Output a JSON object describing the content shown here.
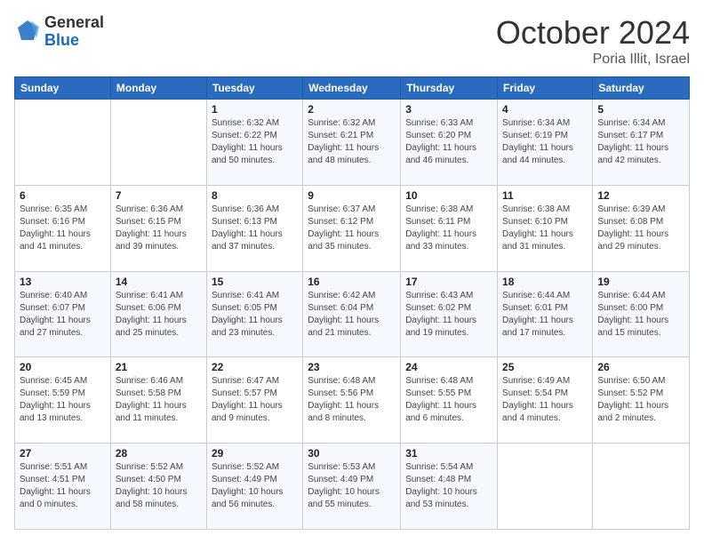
{
  "header": {
    "logo_general": "General",
    "logo_blue": "Blue",
    "month": "October 2024",
    "location": "Poria Illit, Israel"
  },
  "weekdays": [
    "Sunday",
    "Monday",
    "Tuesday",
    "Wednesday",
    "Thursday",
    "Friday",
    "Saturday"
  ],
  "weeks": [
    [
      {
        "day": "",
        "sunrise": "",
        "sunset": "",
        "daylight": ""
      },
      {
        "day": "",
        "sunrise": "",
        "sunset": "",
        "daylight": ""
      },
      {
        "day": "1",
        "sunrise": "Sunrise: 6:32 AM",
        "sunset": "Sunset: 6:22 PM",
        "daylight": "Daylight: 11 hours and 50 minutes."
      },
      {
        "day": "2",
        "sunrise": "Sunrise: 6:32 AM",
        "sunset": "Sunset: 6:21 PM",
        "daylight": "Daylight: 11 hours and 48 minutes."
      },
      {
        "day": "3",
        "sunrise": "Sunrise: 6:33 AM",
        "sunset": "Sunset: 6:20 PM",
        "daylight": "Daylight: 11 hours and 46 minutes."
      },
      {
        "day": "4",
        "sunrise": "Sunrise: 6:34 AM",
        "sunset": "Sunset: 6:19 PM",
        "daylight": "Daylight: 11 hours and 44 minutes."
      },
      {
        "day": "5",
        "sunrise": "Sunrise: 6:34 AM",
        "sunset": "Sunset: 6:17 PM",
        "daylight": "Daylight: 11 hours and 42 minutes."
      }
    ],
    [
      {
        "day": "6",
        "sunrise": "Sunrise: 6:35 AM",
        "sunset": "Sunset: 6:16 PM",
        "daylight": "Daylight: 11 hours and 41 minutes."
      },
      {
        "day": "7",
        "sunrise": "Sunrise: 6:36 AM",
        "sunset": "Sunset: 6:15 PM",
        "daylight": "Daylight: 11 hours and 39 minutes."
      },
      {
        "day": "8",
        "sunrise": "Sunrise: 6:36 AM",
        "sunset": "Sunset: 6:13 PM",
        "daylight": "Daylight: 11 hours and 37 minutes."
      },
      {
        "day": "9",
        "sunrise": "Sunrise: 6:37 AM",
        "sunset": "Sunset: 6:12 PM",
        "daylight": "Daylight: 11 hours and 35 minutes."
      },
      {
        "day": "10",
        "sunrise": "Sunrise: 6:38 AM",
        "sunset": "Sunset: 6:11 PM",
        "daylight": "Daylight: 11 hours and 33 minutes."
      },
      {
        "day": "11",
        "sunrise": "Sunrise: 6:38 AM",
        "sunset": "Sunset: 6:10 PM",
        "daylight": "Daylight: 11 hours and 31 minutes."
      },
      {
        "day": "12",
        "sunrise": "Sunrise: 6:39 AM",
        "sunset": "Sunset: 6:08 PM",
        "daylight": "Daylight: 11 hours and 29 minutes."
      }
    ],
    [
      {
        "day": "13",
        "sunrise": "Sunrise: 6:40 AM",
        "sunset": "Sunset: 6:07 PM",
        "daylight": "Daylight: 11 hours and 27 minutes."
      },
      {
        "day": "14",
        "sunrise": "Sunrise: 6:41 AM",
        "sunset": "Sunset: 6:06 PM",
        "daylight": "Daylight: 11 hours and 25 minutes."
      },
      {
        "day": "15",
        "sunrise": "Sunrise: 6:41 AM",
        "sunset": "Sunset: 6:05 PM",
        "daylight": "Daylight: 11 hours and 23 minutes."
      },
      {
        "day": "16",
        "sunrise": "Sunrise: 6:42 AM",
        "sunset": "Sunset: 6:04 PM",
        "daylight": "Daylight: 11 hours and 21 minutes."
      },
      {
        "day": "17",
        "sunrise": "Sunrise: 6:43 AM",
        "sunset": "Sunset: 6:02 PM",
        "daylight": "Daylight: 11 hours and 19 minutes."
      },
      {
        "day": "18",
        "sunrise": "Sunrise: 6:44 AM",
        "sunset": "Sunset: 6:01 PM",
        "daylight": "Daylight: 11 hours and 17 minutes."
      },
      {
        "day": "19",
        "sunrise": "Sunrise: 6:44 AM",
        "sunset": "Sunset: 6:00 PM",
        "daylight": "Daylight: 11 hours and 15 minutes."
      }
    ],
    [
      {
        "day": "20",
        "sunrise": "Sunrise: 6:45 AM",
        "sunset": "Sunset: 5:59 PM",
        "daylight": "Daylight: 11 hours and 13 minutes."
      },
      {
        "day": "21",
        "sunrise": "Sunrise: 6:46 AM",
        "sunset": "Sunset: 5:58 PM",
        "daylight": "Daylight: 11 hours and 11 minutes."
      },
      {
        "day": "22",
        "sunrise": "Sunrise: 6:47 AM",
        "sunset": "Sunset: 5:57 PM",
        "daylight": "Daylight: 11 hours and 9 minutes."
      },
      {
        "day": "23",
        "sunrise": "Sunrise: 6:48 AM",
        "sunset": "Sunset: 5:56 PM",
        "daylight": "Daylight: 11 hours and 8 minutes."
      },
      {
        "day": "24",
        "sunrise": "Sunrise: 6:48 AM",
        "sunset": "Sunset: 5:55 PM",
        "daylight": "Daylight: 11 hours and 6 minutes."
      },
      {
        "day": "25",
        "sunrise": "Sunrise: 6:49 AM",
        "sunset": "Sunset: 5:54 PM",
        "daylight": "Daylight: 11 hours and 4 minutes."
      },
      {
        "day": "26",
        "sunrise": "Sunrise: 6:50 AM",
        "sunset": "Sunset: 5:52 PM",
        "daylight": "Daylight: 11 hours and 2 minutes."
      }
    ],
    [
      {
        "day": "27",
        "sunrise": "Sunrise: 5:51 AM",
        "sunset": "Sunset: 4:51 PM",
        "daylight": "Daylight: 11 hours and 0 minutes."
      },
      {
        "day": "28",
        "sunrise": "Sunrise: 5:52 AM",
        "sunset": "Sunset: 4:50 PM",
        "daylight": "Daylight: 10 hours and 58 minutes."
      },
      {
        "day": "29",
        "sunrise": "Sunrise: 5:52 AM",
        "sunset": "Sunset: 4:49 PM",
        "daylight": "Daylight: 10 hours and 56 minutes."
      },
      {
        "day": "30",
        "sunrise": "Sunrise: 5:53 AM",
        "sunset": "Sunset: 4:49 PM",
        "daylight": "Daylight: 10 hours and 55 minutes."
      },
      {
        "day": "31",
        "sunrise": "Sunrise: 5:54 AM",
        "sunset": "Sunset: 4:48 PM",
        "daylight": "Daylight: 10 hours and 53 minutes."
      },
      {
        "day": "",
        "sunrise": "",
        "sunset": "",
        "daylight": ""
      },
      {
        "day": "",
        "sunrise": "",
        "sunset": "",
        "daylight": ""
      }
    ]
  ]
}
